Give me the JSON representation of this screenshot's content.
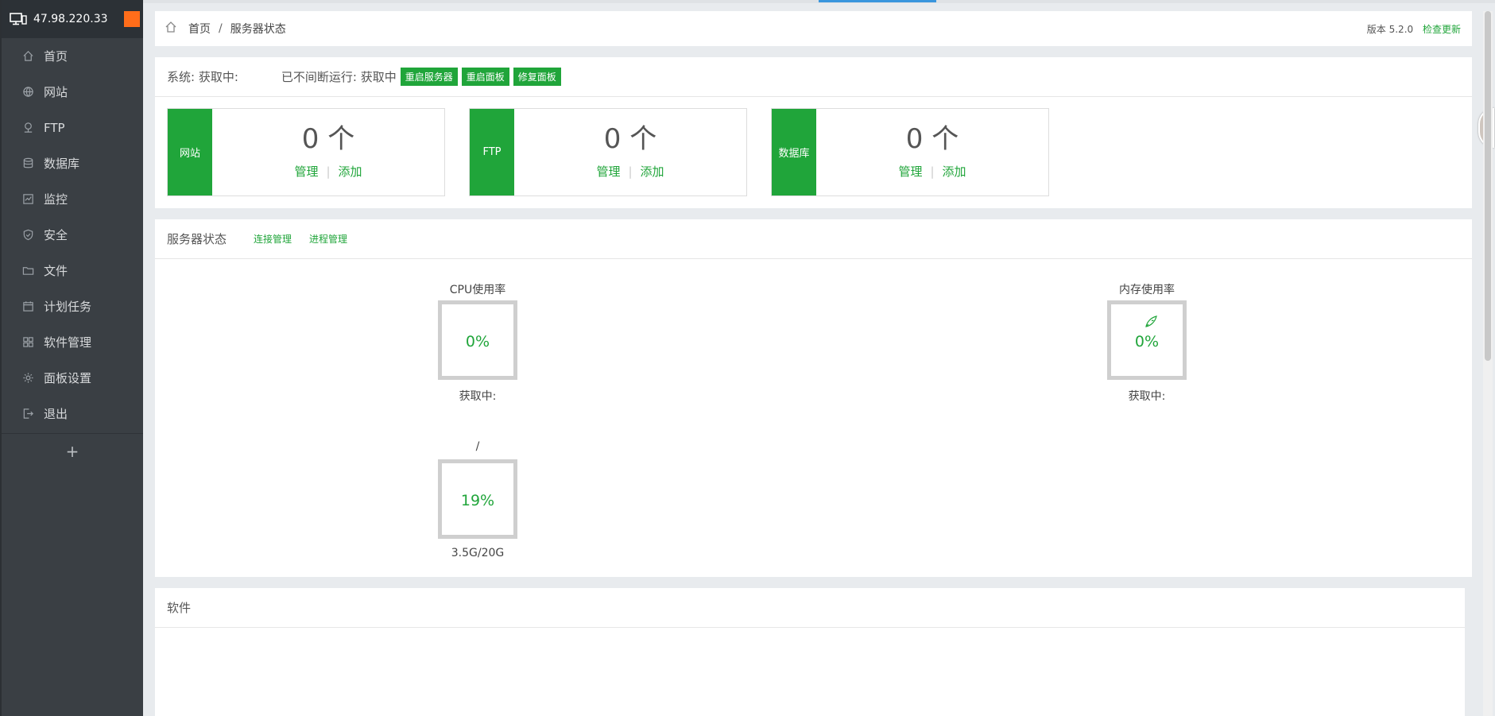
{
  "sidebar": {
    "ip": "47.98.220.33",
    "items": [
      {
        "label": "首页",
        "icon": "home-icon"
      },
      {
        "label": "网站",
        "icon": "globe-icon"
      },
      {
        "label": "FTP",
        "icon": "ftp-icon"
      },
      {
        "label": "数据库",
        "icon": "database-icon"
      },
      {
        "label": "监控",
        "icon": "monitor-icon"
      },
      {
        "label": "安全",
        "icon": "shield-icon"
      },
      {
        "label": "文件",
        "icon": "folder-icon"
      },
      {
        "label": "计划任务",
        "icon": "calendar-icon"
      },
      {
        "label": "软件管理",
        "icon": "grid-icon"
      },
      {
        "label": "面板设置",
        "icon": "gear-icon"
      },
      {
        "label": "退出",
        "icon": "logout-icon"
      }
    ],
    "add_label": "+"
  },
  "breadcrumb": {
    "home": "首页",
    "sep": "/",
    "current": "服务器状态"
  },
  "version": {
    "label": "版本 5.2.0",
    "check_update": "检查更新"
  },
  "system": {
    "os": "系统: 获取中:",
    "uptime": "已不间断运行: 获取中",
    "buttons": [
      "重启服务器",
      "重启面板",
      "修复面板"
    ]
  },
  "stats": [
    {
      "tag": "网站",
      "count": "0 个",
      "manage": "管理",
      "add": "添加"
    },
    {
      "tag": "FTP",
      "count": "0 个",
      "manage": "管理",
      "add": "添加"
    },
    {
      "tag": "数据库",
      "count": "0 个",
      "manage": "管理",
      "add": "添加"
    }
  ],
  "server_status": {
    "title": "服务器状态",
    "links": [
      "连接管理",
      "进程管理"
    ],
    "gauges": [
      {
        "label": "CPU使用率",
        "value": "0%",
        "sub": "获取中:"
      },
      {
        "label": "内存使用率",
        "value": "0%",
        "sub": "获取中:"
      },
      {
        "label": "/",
        "value": "19%",
        "sub": "3.5G/20G"
      }
    ]
  },
  "software": {
    "title": "软件"
  },
  "colors": {
    "accent": "#20a53a",
    "sidebar_bg": "#3a3f44",
    "orange": "#ff6d1a"
  }
}
